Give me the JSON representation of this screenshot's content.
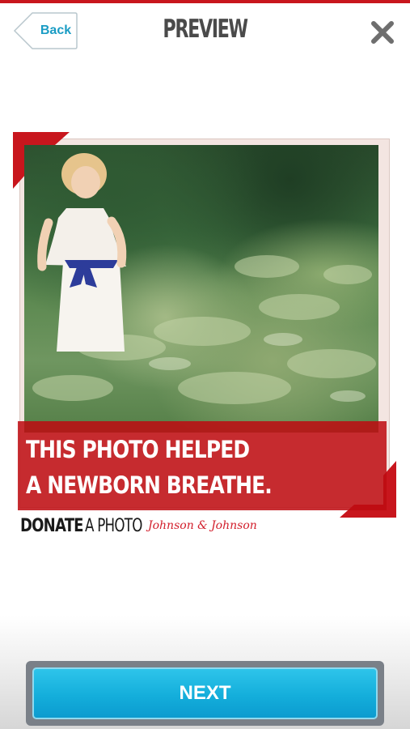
{
  "header": {
    "back_label": "Back",
    "title": "PREVIEW",
    "close_icon": "close-icon"
  },
  "card": {
    "banner_line1": "THIS PHOTO HELPED",
    "banner_line2": "A NEWBORN BREATHE.",
    "photo_icon": "photo-girl-in-garden"
  },
  "brand": {
    "donate": "DONATE",
    "a_photo": "A PHOTO",
    "sponsor": "Johnson & Johnson"
  },
  "footer": {
    "next_label": "NEXT"
  },
  "colors": {
    "accent_red": "#c8161d",
    "button_blue": "#14aedb",
    "back_text": "#1a9cc4"
  }
}
